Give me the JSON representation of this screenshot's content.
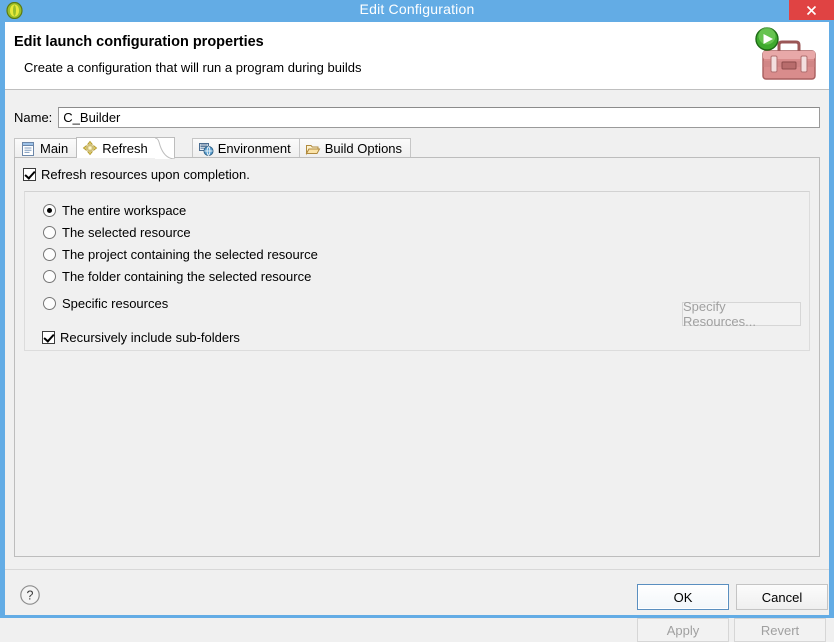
{
  "window": {
    "title": "Edit Configuration",
    "app_icon": "eclipse-icon",
    "close_label": "✕"
  },
  "header": {
    "title": "Edit launch configuration properties",
    "subtitle": "Create a configuration that will run a program during builds",
    "icon": "toolbox-run-icon"
  },
  "name_field": {
    "label": "Name:",
    "value": "C_Builder",
    "placeholder": ""
  },
  "tabs": [
    {
      "label": "Main",
      "icon": "main-document-icon",
      "active": false
    },
    {
      "label": "Refresh",
      "icon": "refresh-arrows-icon",
      "active": true
    },
    {
      "label": "Environment",
      "icon": "environment-icon",
      "active": false
    },
    {
      "label": "Build Options",
      "icon": "build-folder-icon",
      "active": false
    }
  ],
  "refresh_tab": {
    "enable_checkbox": {
      "label": "Refresh resources upon completion.",
      "checked": true
    },
    "scope_options": [
      {
        "label": "The entire workspace",
        "selected": true
      },
      {
        "label": "The selected resource",
        "selected": false
      },
      {
        "label": "The project containing the selected resource",
        "selected": false
      },
      {
        "label": "The folder containing the selected resource",
        "selected": false
      },
      {
        "label": "Specific resources",
        "selected": false
      }
    ],
    "recursive_checkbox": {
      "label": "Recursively include sub-folders",
      "checked": true
    },
    "specify_button": {
      "label": "Specify Resources...",
      "enabled": false
    }
  },
  "action_buttons": {
    "apply": {
      "label": "Apply",
      "enabled": false
    },
    "revert": {
      "label": "Revert",
      "enabled": false
    }
  },
  "footer": {
    "help_icon": "help-question-icon",
    "ok": {
      "label": "OK",
      "default": true
    },
    "cancel": {
      "label": "Cancel",
      "default": false
    }
  },
  "colors": {
    "titlebar": "#63ace5",
    "close_button": "#e04343",
    "dialog_bg": "#f0f0f0",
    "header_bg": "#ffffff",
    "focus_border": "#5a8fc0"
  }
}
